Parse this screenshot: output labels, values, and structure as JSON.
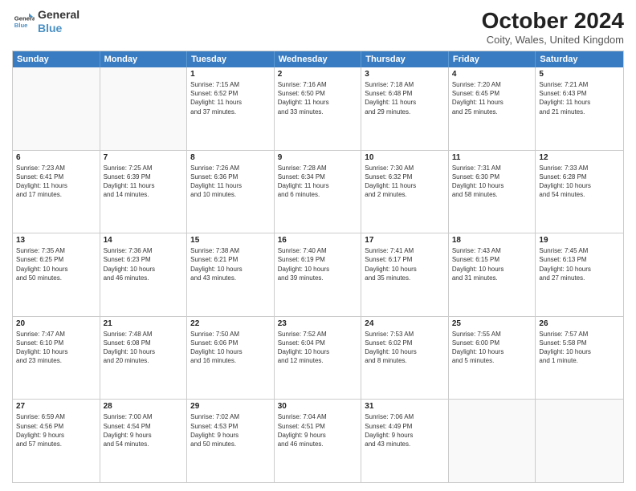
{
  "header": {
    "logo_line1": "General",
    "logo_line2": "Blue",
    "month_title": "October 2024",
    "location": "Coity, Wales, United Kingdom"
  },
  "day_headers": [
    "Sunday",
    "Monday",
    "Tuesday",
    "Wednesday",
    "Thursday",
    "Friday",
    "Saturday"
  ],
  "weeks": [
    [
      {
        "num": "",
        "info": ""
      },
      {
        "num": "",
        "info": ""
      },
      {
        "num": "1",
        "info": "Sunrise: 7:15 AM\nSunset: 6:52 PM\nDaylight: 11 hours\nand 37 minutes."
      },
      {
        "num": "2",
        "info": "Sunrise: 7:16 AM\nSunset: 6:50 PM\nDaylight: 11 hours\nand 33 minutes."
      },
      {
        "num": "3",
        "info": "Sunrise: 7:18 AM\nSunset: 6:48 PM\nDaylight: 11 hours\nand 29 minutes."
      },
      {
        "num": "4",
        "info": "Sunrise: 7:20 AM\nSunset: 6:45 PM\nDaylight: 11 hours\nand 25 minutes."
      },
      {
        "num": "5",
        "info": "Sunrise: 7:21 AM\nSunset: 6:43 PM\nDaylight: 11 hours\nand 21 minutes."
      }
    ],
    [
      {
        "num": "6",
        "info": "Sunrise: 7:23 AM\nSunset: 6:41 PM\nDaylight: 11 hours\nand 17 minutes."
      },
      {
        "num": "7",
        "info": "Sunrise: 7:25 AM\nSunset: 6:39 PM\nDaylight: 11 hours\nand 14 minutes."
      },
      {
        "num": "8",
        "info": "Sunrise: 7:26 AM\nSunset: 6:36 PM\nDaylight: 11 hours\nand 10 minutes."
      },
      {
        "num": "9",
        "info": "Sunrise: 7:28 AM\nSunset: 6:34 PM\nDaylight: 11 hours\nand 6 minutes."
      },
      {
        "num": "10",
        "info": "Sunrise: 7:30 AM\nSunset: 6:32 PM\nDaylight: 11 hours\nand 2 minutes."
      },
      {
        "num": "11",
        "info": "Sunrise: 7:31 AM\nSunset: 6:30 PM\nDaylight: 10 hours\nand 58 minutes."
      },
      {
        "num": "12",
        "info": "Sunrise: 7:33 AM\nSunset: 6:28 PM\nDaylight: 10 hours\nand 54 minutes."
      }
    ],
    [
      {
        "num": "13",
        "info": "Sunrise: 7:35 AM\nSunset: 6:25 PM\nDaylight: 10 hours\nand 50 minutes."
      },
      {
        "num": "14",
        "info": "Sunrise: 7:36 AM\nSunset: 6:23 PM\nDaylight: 10 hours\nand 46 minutes."
      },
      {
        "num": "15",
        "info": "Sunrise: 7:38 AM\nSunset: 6:21 PM\nDaylight: 10 hours\nand 43 minutes."
      },
      {
        "num": "16",
        "info": "Sunrise: 7:40 AM\nSunset: 6:19 PM\nDaylight: 10 hours\nand 39 minutes."
      },
      {
        "num": "17",
        "info": "Sunrise: 7:41 AM\nSunset: 6:17 PM\nDaylight: 10 hours\nand 35 minutes."
      },
      {
        "num": "18",
        "info": "Sunrise: 7:43 AM\nSunset: 6:15 PM\nDaylight: 10 hours\nand 31 minutes."
      },
      {
        "num": "19",
        "info": "Sunrise: 7:45 AM\nSunset: 6:13 PM\nDaylight: 10 hours\nand 27 minutes."
      }
    ],
    [
      {
        "num": "20",
        "info": "Sunrise: 7:47 AM\nSunset: 6:10 PM\nDaylight: 10 hours\nand 23 minutes."
      },
      {
        "num": "21",
        "info": "Sunrise: 7:48 AM\nSunset: 6:08 PM\nDaylight: 10 hours\nand 20 minutes."
      },
      {
        "num": "22",
        "info": "Sunrise: 7:50 AM\nSunset: 6:06 PM\nDaylight: 10 hours\nand 16 minutes."
      },
      {
        "num": "23",
        "info": "Sunrise: 7:52 AM\nSunset: 6:04 PM\nDaylight: 10 hours\nand 12 minutes."
      },
      {
        "num": "24",
        "info": "Sunrise: 7:53 AM\nSunset: 6:02 PM\nDaylight: 10 hours\nand 8 minutes."
      },
      {
        "num": "25",
        "info": "Sunrise: 7:55 AM\nSunset: 6:00 PM\nDaylight: 10 hours\nand 5 minutes."
      },
      {
        "num": "26",
        "info": "Sunrise: 7:57 AM\nSunset: 5:58 PM\nDaylight: 10 hours\nand 1 minute."
      }
    ],
    [
      {
        "num": "27",
        "info": "Sunrise: 6:59 AM\nSunset: 4:56 PM\nDaylight: 9 hours\nand 57 minutes."
      },
      {
        "num": "28",
        "info": "Sunrise: 7:00 AM\nSunset: 4:54 PM\nDaylight: 9 hours\nand 54 minutes."
      },
      {
        "num": "29",
        "info": "Sunrise: 7:02 AM\nSunset: 4:53 PM\nDaylight: 9 hours\nand 50 minutes."
      },
      {
        "num": "30",
        "info": "Sunrise: 7:04 AM\nSunset: 4:51 PM\nDaylight: 9 hours\nand 46 minutes."
      },
      {
        "num": "31",
        "info": "Sunrise: 7:06 AM\nSunset: 4:49 PM\nDaylight: 9 hours\nand 43 minutes."
      },
      {
        "num": "",
        "info": ""
      },
      {
        "num": "",
        "info": ""
      }
    ]
  ]
}
